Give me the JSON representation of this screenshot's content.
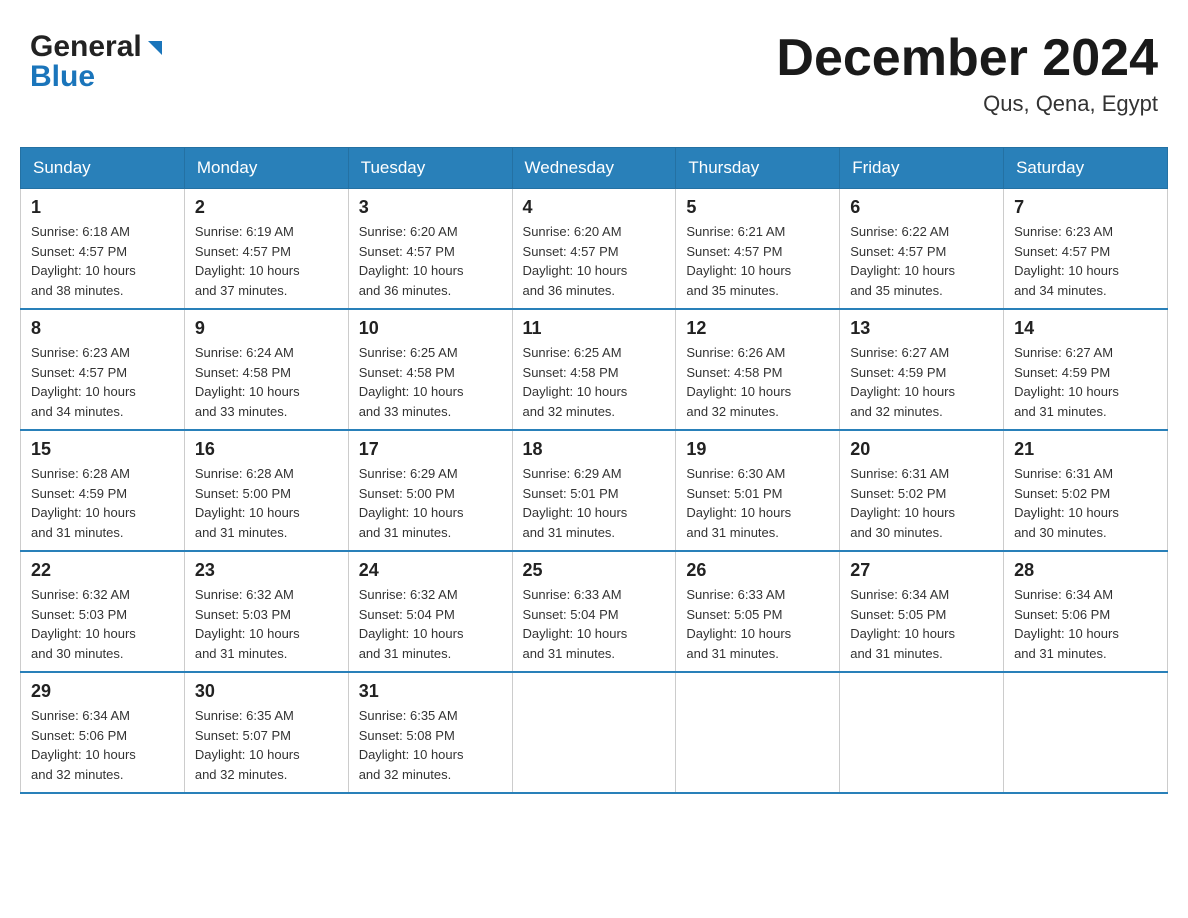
{
  "header": {
    "logo_general": "General",
    "logo_blue": "Blue",
    "month_title": "December 2024",
    "location": "Qus, Qena, Egypt"
  },
  "weekdays": [
    "Sunday",
    "Monday",
    "Tuesday",
    "Wednesday",
    "Thursday",
    "Friday",
    "Saturday"
  ],
  "weeks": [
    [
      {
        "day": "1",
        "sunrise": "6:18 AM",
        "sunset": "4:57 PM",
        "daylight": "10 hours and 38 minutes."
      },
      {
        "day": "2",
        "sunrise": "6:19 AM",
        "sunset": "4:57 PM",
        "daylight": "10 hours and 37 minutes."
      },
      {
        "day": "3",
        "sunrise": "6:20 AM",
        "sunset": "4:57 PM",
        "daylight": "10 hours and 36 minutes."
      },
      {
        "day": "4",
        "sunrise": "6:20 AM",
        "sunset": "4:57 PM",
        "daylight": "10 hours and 36 minutes."
      },
      {
        "day": "5",
        "sunrise": "6:21 AM",
        "sunset": "4:57 PM",
        "daylight": "10 hours and 35 minutes."
      },
      {
        "day": "6",
        "sunrise": "6:22 AM",
        "sunset": "4:57 PM",
        "daylight": "10 hours and 35 minutes."
      },
      {
        "day": "7",
        "sunrise": "6:23 AM",
        "sunset": "4:57 PM",
        "daylight": "10 hours and 34 minutes."
      }
    ],
    [
      {
        "day": "8",
        "sunrise": "6:23 AM",
        "sunset": "4:57 PM",
        "daylight": "10 hours and 34 minutes."
      },
      {
        "day": "9",
        "sunrise": "6:24 AM",
        "sunset": "4:58 PM",
        "daylight": "10 hours and 33 minutes."
      },
      {
        "day": "10",
        "sunrise": "6:25 AM",
        "sunset": "4:58 PM",
        "daylight": "10 hours and 33 minutes."
      },
      {
        "day": "11",
        "sunrise": "6:25 AM",
        "sunset": "4:58 PM",
        "daylight": "10 hours and 32 minutes."
      },
      {
        "day": "12",
        "sunrise": "6:26 AM",
        "sunset": "4:58 PM",
        "daylight": "10 hours and 32 minutes."
      },
      {
        "day": "13",
        "sunrise": "6:27 AM",
        "sunset": "4:59 PM",
        "daylight": "10 hours and 32 minutes."
      },
      {
        "day": "14",
        "sunrise": "6:27 AM",
        "sunset": "4:59 PM",
        "daylight": "10 hours and 31 minutes."
      }
    ],
    [
      {
        "day": "15",
        "sunrise": "6:28 AM",
        "sunset": "4:59 PM",
        "daylight": "10 hours and 31 minutes."
      },
      {
        "day": "16",
        "sunrise": "6:28 AM",
        "sunset": "5:00 PM",
        "daylight": "10 hours and 31 minutes."
      },
      {
        "day": "17",
        "sunrise": "6:29 AM",
        "sunset": "5:00 PM",
        "daylight": "10 hours and 31 minutes."
      },
      {
        "day": "18",
        "sunrise": "6:29 AM",
        "sunset": "5:01 PM",
        "daylight": "10 hours and 31 minutes."
      },
      {
        "day": "19",
        "sunrise": "6:30 AM",
        "sunset": "5:01 PM",
        "daylight": "10 hours and 31 minutes."
      },
      {
        "day": "20",
        "sunrise": "6:31 AM",
        "sunset": "5:02 PM",
        "daylight": "10 hours and 30 minutes."
      },
      {
        "day": "21",
        "sunrise": "6:31 AM",
        "sunset": "5:02 PM",
        "daylight": "10 hours and 30 minutes."
      }
    ],
    [
      {
        "day": "22",
        "sunrise": "6:32 AM",
        "sunset": "5:03 PM",
        "daylight": "10 hours and 30 minutes."
      },
      {
        "day": "23",
        "sunrise": "6:32 AM",
        "sunset": "5:03 PM",
        "daylight": "10 hours and 31 minutes."
      },
      {
        "day": "24",
        "sunrise": "6:32 AM",
        "sunset": "5:04 PM",
        "daylight": "10 hours and 31 minutes."
      },
      {
        "day": "25",
        "sunrise": "6:33 AM",
        "sunset": "5:04 PM",
        "daylight": "10 hours and 31 minutes."
      },
      {
        "day": "26",
        "sunrise": "6:33 AM",
        "sunset": "5:05 PM",
        "daylight": "10 hours and 31 minutes."
      },
      {
        "day": "27",
        "sunrise": "6:34 AM",
        "sunset": "5:05 PM",
        "daylight": "10 hours and 31 minutes."
      },
      {
        "day": "28",
        "sunrise": "6:34 AM",
        "sunset": "5:06 PM",
        "daylight": "10 hours and 31 minutes."
      }
    ],
    [
      {
        "day": "29",
        "sunrise": "6:34 AM",
        "sunset": "5:06 PM",
        "daylight": "10 hours and 32 minutes."
      },
      {
        "day": "30",
        "sunrise": "6:35 AM",
        "sunset": "5:07 PM",
        "daylight": "10 hours and 32 minutes."
      },
      {
        "day": "31",
        "sunrise": "6:35 AM",
        "sunset": "5:08 PM",
        "daylight": "10 hours and 32 minutes."
      },
      null,
      null,
      null,
      null
    ]
  ],
  "labels": {
    "sunrise": "Sunrise:",
    "sunset": "Sunset:",
    "daylight": "Daylight:"
  }
}
